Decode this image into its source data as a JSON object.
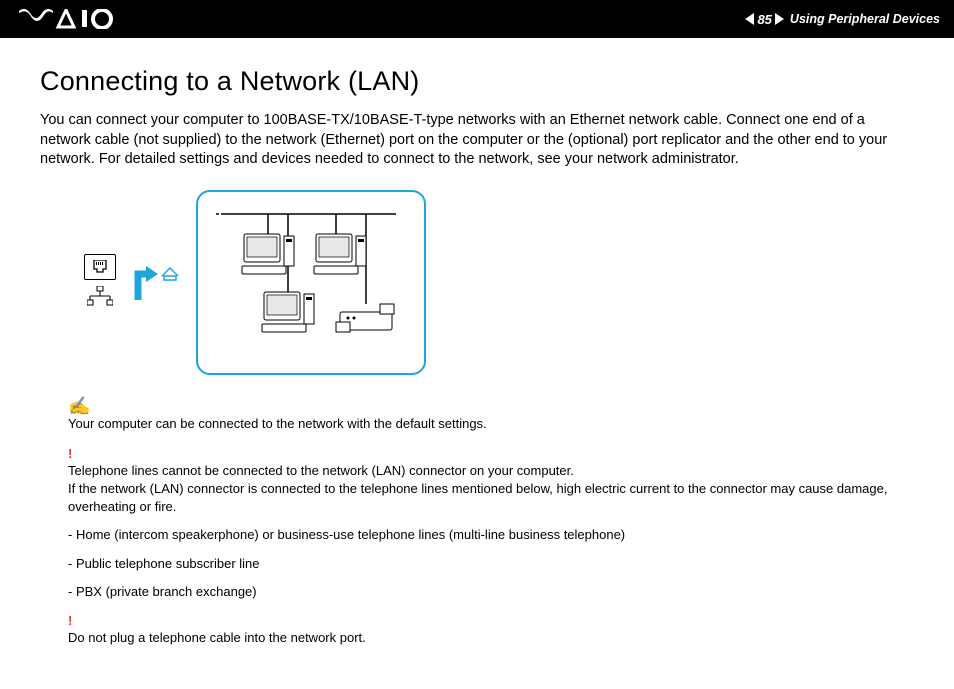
{
  "header": {
    "page_number": "85",
    "section": "Using Peripheral Devices"
  },
  "title": "Connecting to a Network (LAN)",
  "intro": "You can connect your computer to 100BASE-TX/10BASE-T-type networks with an Ethernet network cable. Connect one end of a network cable (not supplied) to the network (Ethernet) port on the computer or the (optional) port replicator and the other end to your network. For detailed settings and devices needed to connect to the network, see your network administrator.",
  "note": {
    "text": "Your computer can be connected to the network with the default settings."
  },
  "warning1": {
    "line1": "Telephone lines cannot be connected to the network (LAN) connector on your computer.",
    "line2": "If the network (LAN) connector is connected to the telephone lines mentioned below, high electric current to the connector may cause damage, overheating or fire.",
    "items": [
      "Home (intercom speakerphone) or business-use telephone lines (multi-line business telephone)",
      "Public telephone subscriber line",
      "PBX (private branch exchange)"
    ]
  },
  "warning2": {
    "text": "Do not plug a telephone cable into the network port."
  }
}
